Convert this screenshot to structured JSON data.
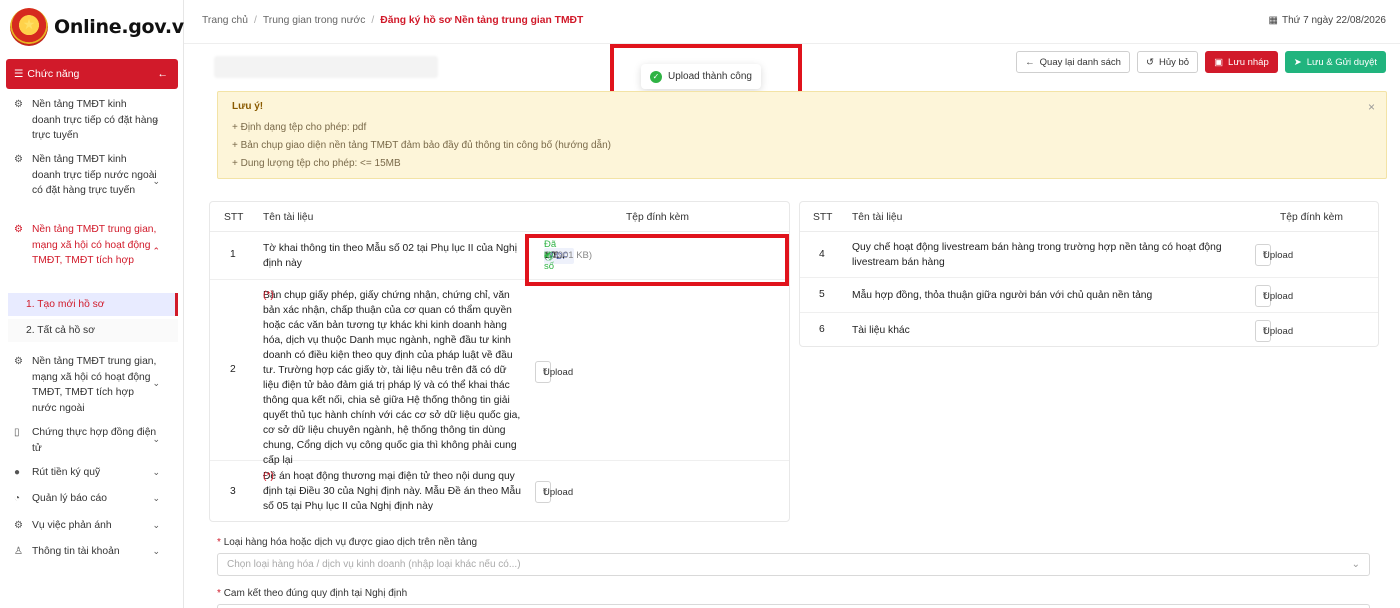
{
  "brand": {
    "name": "Online.gov.vn"
  },
  "menu": {
    "header": "Chức năng",
    "items": [
      {
        "label": "Nền tảng TMĐT kinh doanh trực tiếp có đặt hàng trực tuyến",
        "icon": "gear-icon"
      },
      {
        "label": "Nền tảng TMĐT kinh doanh trực tiếp nước ngoài có đặt hàng trực tuyến",
        "icon": "gear-icon"
      },
      {
        "label": "Nền tảng TMĐT trung gian, mạng xã hội có hoạt động TMĐT, TMĐT tích hợp",
        "icon": "gear-icon",
        "children": [
          "1. Tạo mới hồ sơ",
          "2. Tất cả hồ sơ"
        ]
      },
      {
        "label": "Nền tảng TMĐT trung gian, mạng xã hội có hoạt động TMĐT, TMĐT tích hợp nước ngoài",
        "icon": "gear-icon"
      },
      {
        "label": "Chứng thực hợp đồng điện tử",
        "icon": "document-icon"
      },
      {
        "label": "Rút tiền ký quỹ",
        "icon": "money-icon"
      },
      {
        "label": "Quản lý báo cáo",
        "icon": "dashboard-icon"
      },
      {
        "label": "Vụ việc phản ánh",
        "icon": "gear-icon"
      },
      {
        "label": "Thông tin tài khoản",
        "icon": "user-icon"
      }
    ]
  },
  "breadcrumb": [
    "Trang chủ",
    "Trung gian trong nước",
    "Đăng ký hồ sơ Nền tảng trung gian TMĐT"
  ],
  "date": "Thứ 7 ngày 22/08/2026",
  "actions": {
    "back": "Quay lại danh sách",
    "cancel": "Hủy bỏ",
    "draft": "Lưu nháp",
    "submit": "Lưu & Gửi duyệt"
  },
  "toast": "Upload thành công",
  "note": {
    "title": "Lưu ý!",
    "lines": [
      "+ Định dạng tệp cho phép: pdf",
      "+ Bản chụp giao diện nền tảng TMĐT đảm bảo đầy đủ thông tin công bố (hướng dẫn)",
      "+ Dung lượng tệp cho phép: <= 15MB"
    ]
  },
  "table": {
    "headers": {
      "stt": "STT",
      "name": "Tên tài liệu",
      "file": "Tệp đính kèm"
    },
    "upload_label": "Upload",
    "required_mark": "(*)",
    "left_rows": [
      {
        "stt": "1",
        "name": "Tờ khai thông tin theo Mẫu số 02 tại Phụ lục II của Nghị định này",
        "file": {
          "type": "PDF",
          "name": "1.T...",
          "size": "(12901 KB)",
          "status": "Đã ký số"
        }
      },
      {
        "stt": "2",
        "name": "Bản chụp giấy phép, giấy chứng nhận, chứng chỉ, văn bản xác nhận, chấp thuận của cơ quan có thẩm quyền hoặc các văn bản tương tự khác khi kinh doanh hàng hóa, dịch vụ thuộc Danh mục ngành, nghề đầu tư kinh doanh có điều kiện theo quy định của pháp luật về đầu tư. Trường hợp các giấy tờ, tài liệu nêu trên đã có dữ liệu điện tử bảo đảm giá trị pháp lý và có thể khai thác thông qua kết nối, chia sẻ giữa Hệ thống thông tin giải quyết thủ tục hành chính với các cơ sở dữ liệu quốc gia, cơ sở dữ liệu chuyên ngành, hệ thống thông tin dùng chung, Cổng dịch vụ công quốc gia thì không phải cung cấp lại",
        "required": true
      },
      {
        "stt": "3",
        "name": "Đề án hoạt động thương mại điện tử theo nội dung quy định tại Điều 30 của Nghị định này. Mẫu Đề án theo Mẫu số 05 tại Phụ lục II của Nghị định này",
        "required": true
      }
    ],
    "right_rows": [
      {
        "stt": "4",
        "name": "Quy chế hoạt động livestream bán hàng trong trường hợp nền tảng có hoạt động livestream bán hàng"
      },
      {
        "stt": "5",
        "name": "Mẫu hợp đồng, thỏa thuận giữa người bán với chủ quản nền tảng"
      },
      {
        "stt": "6",
        "name": "Tài liệu khác"
      }
    ]
  },
  "form": {
    "goods_label": "Loại hàng hóa hoặc dịch vụ được giao dịch trên nền tảng",
    "goods_placeholder": "Chọn loại hàng hóa / dịch vụ kinh doanh (nhập loại khác nếu có...)",
    "commit_label": "Cam kết theo đúng quy định tại Nghị định",
    "required_star": "*"
  },
  "colors": {
    "brand_red": "#d11a2a",
    "success_green": "#21b47e",
    "highlight_red": "#e0131c",
    "note_bg": "#fdf5d9"
  }
}
